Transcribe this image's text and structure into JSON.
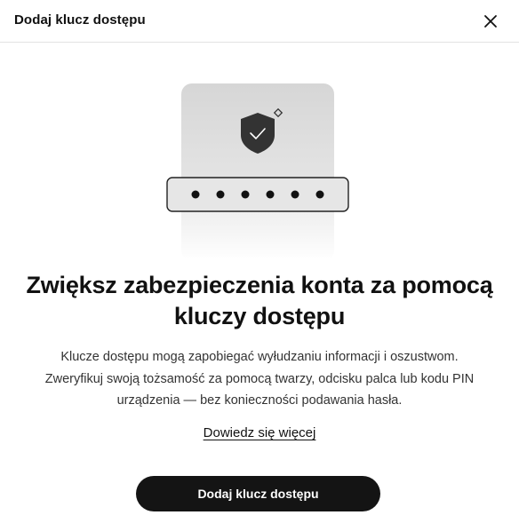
{
  "dialog": {
    "title": "Dodaj klucz dostępu",
    "close_icon": "close-icon"
  },
  "illustration": {
    "icons": [
      "shield-check-icon",
      "diamond-sparkle-icon"
    ],
    "password_dot_count": 6
  },
  "content": {
    "title_lines": [
      "Zwiększ zabezpieczenia konta za pomocą",
      "kluczy dostępu"
    ],
    "description_lines": [
      "Klucze dostępu mogą zapobiegać wyłudzaniu informacji i oszustwom.",
      "Zweryfikuj swoją tożsamość za pomocą twarzy, odcisku palca lub kodu PIN",
      "urządzenia — bez konieczności podawania hasła."
    ],
    "learn_more": "Dowiedz się więcej"
  },
  "actions": {
    "primary_label": "Dodaj klucz dostępu"
  },
  "colors": {
    "primary_button": "#141414",
    "card_gray": "#d8d8d8",
    "text": "#111111"
  }
}
